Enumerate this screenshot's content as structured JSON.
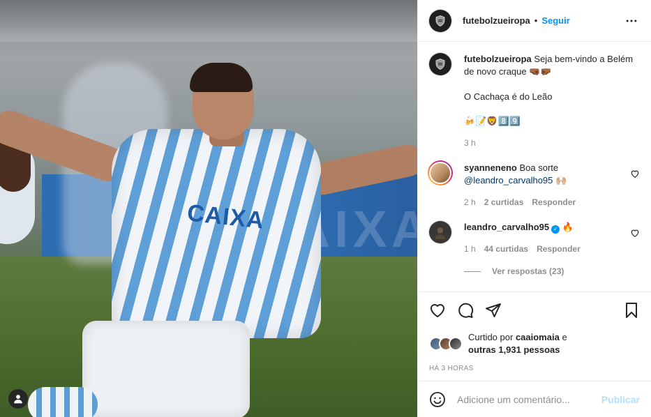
{
  "post": {
    "photo_alt": "Jogador comemorando com camisa listrada azul e branca",
    "sponsor_text": "CAIXA"
  },
  "header": {
    "username": "futebolzueiropa",
    "separator": "•",
    "follow_label": "Seguir",
    "more_icon": "more-horizontal-icon"
  },
  "caption": {
    "username": "futebolzueiropa",
    "line1": "Seja bem-vindo a Belém de novo craque 🤜🏾🤛🏾",
    "line2": "O Cachaça é do Leão",
    "line3": "🍻📝🦁8️⃣9️⃣",
    "time": "3 h"
  },
  "comments": [
    {
      "username": "syanneneno",
      "text": "Boa sorte",
      "mention": "@leandro_carvalho95",
      "emoji": "🙌🏼",
      "time": "2 h",
      "likes": "2 curtidas",
      "reply_label": "Responder"
    },
    {
      "username": "leandro_carvalho95",
      "verified": true,
      "text": "🔥",
      "time": "1 h",
      "likes": "44 curtidas",
      "reply_label": "Responder"
    }
  ],
  "view_replies": "Ver respostas (23)",
  "likes": {
    "prefix": "Curtido por",
    "user": "caaiomaia",
    "connector": "e",
    "others": "outras 1,931 pessoas"
  },
  "post_time": "HÁ 3 HORAS",
  "add_comment": {
    "placeholder": "Adicione um comentário...",
    "publish_label": "Publicar"
  },
  "colors": {
    "accent": "#0095f6",
    "publish_disabled": "#b2dffc",
    "muted": "#8e8e8e",
    "text": "#262626"
  }
}
